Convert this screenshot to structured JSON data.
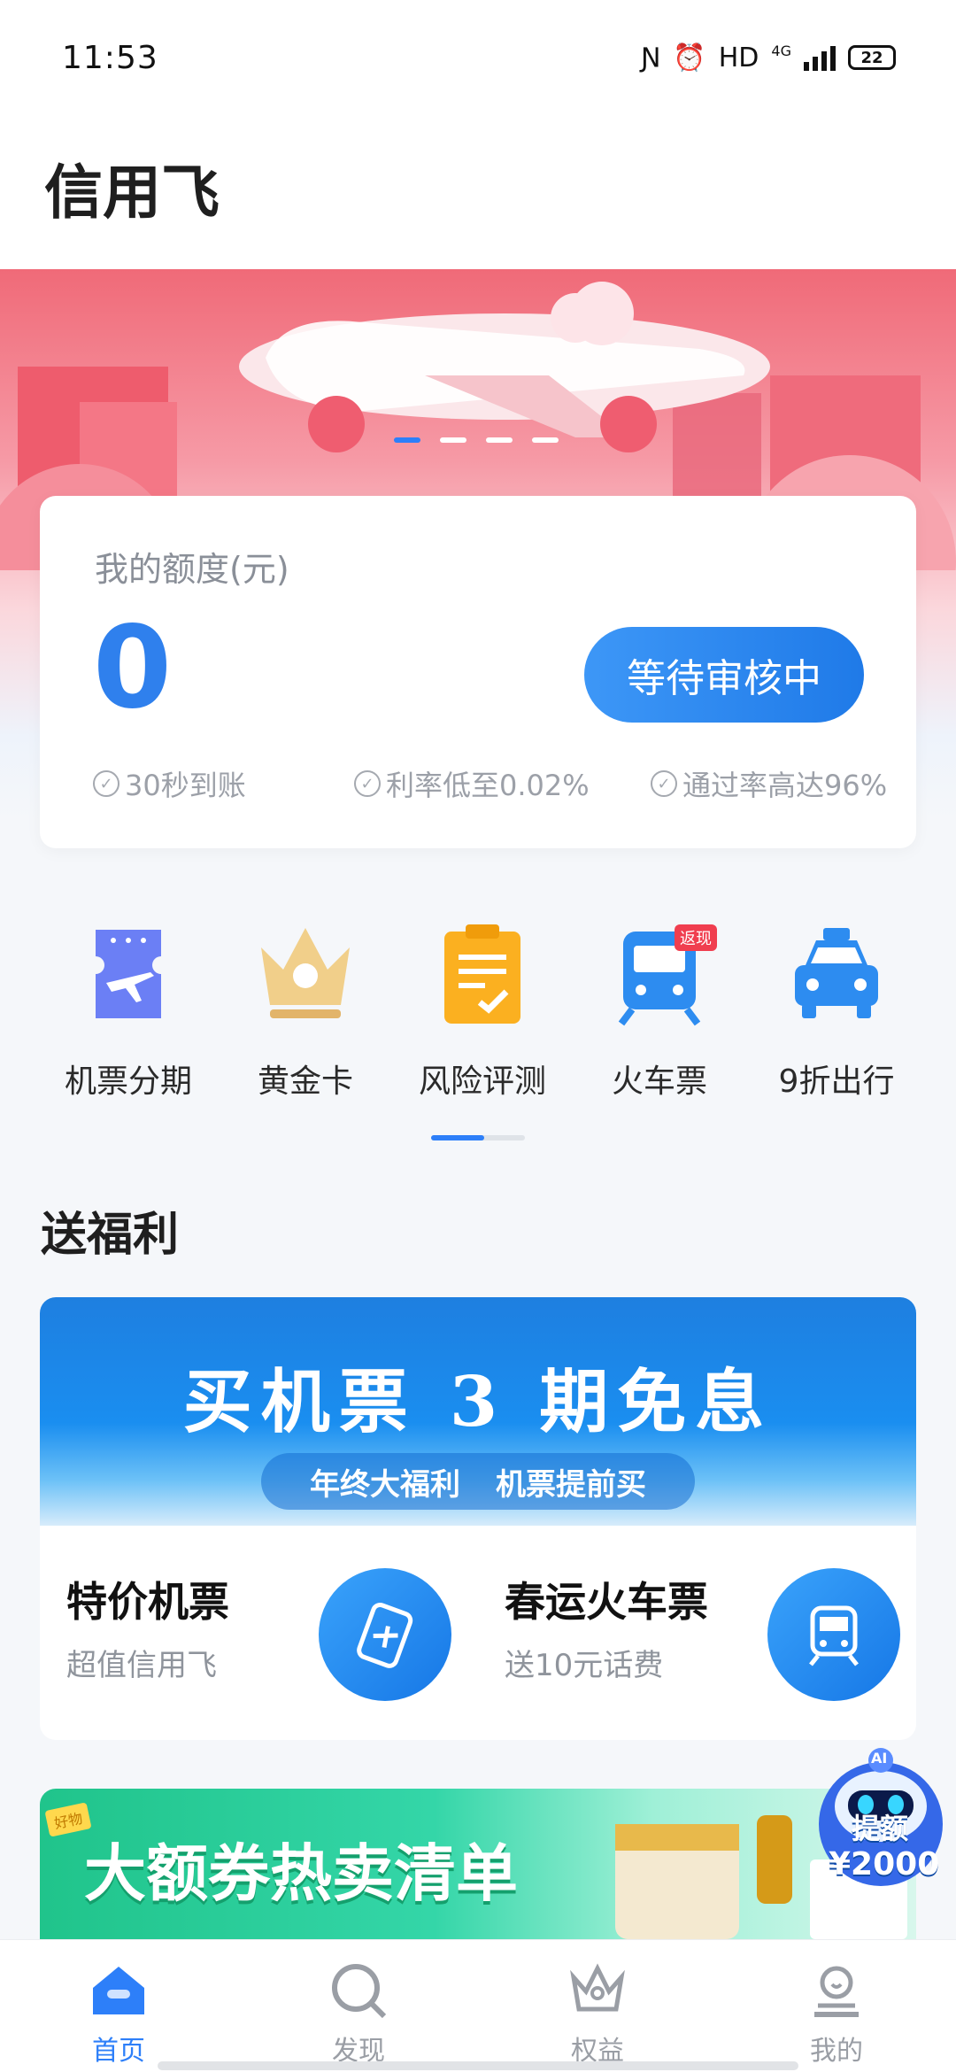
{
  "status_bar": {
    "time": "11:53",
    "hd": "HD",
    "network": "4G",
    "battery": "22"
  },
  "header": {
    "title": "信用飞"
  },
  "colors": {
    "accent": "#2d7ff9",
    "brand_red": "#f06a78",
    "green": "#20c48b"
  },
  "credit": {
    "label": "我的额度(元)",
    "amount": "0",
    "button": "等待审核中",
    "features": [
      "30秒到账",
      "利率低至0.02%",
      "通过率高达96%"
    ]
  },
  "quick_entries": [
    {
      "label": "机票分期",
      "icon": "ticket-plane-icon"
    },
    {
      "label": "黄金卡",
      "icon": "crown-icon"
    },
    {
      "label": "风险评测",
      "icon": "clipboard-icon"
    },
    {
      "label": "火车票",
      "icon": "train-icon",
      "tag": "返现"
    },
    {
      "label": "9折出行",
      "icon": "taxi-icon"
    }
  ],
  "welfare": {
    "title": "送福利",
    "banner_headline": "买机票 3 期免息",
    "banner_sub_1": "年终大福利",
    "banner_sub_2": "机票提前买",
    "promos": [
      {
        "title": "特价机票",
        "subtitle": "超值信用飞",
        "icon": "plane-ticket-icon"
      },
      {
        "title": "春运火车票",
        "subtitle": "送10元话费",
        "icon": "train-icon"
      }
    ]
  },
  "coupon": {
    "title": "大额券热卖清单",
    "tag": "好物"
  },
  "ai_bot": {
    "badge": "AI",
    "label": "提额",
    "amount": "¥2000"
  },
  "bottom_nav": [
    {
      "label": "首页",
      "icon": "home-icon",
      "active": true
    },
    {
      "label": "发现",
      "icon": "search-icon",
      "active": false
    },
    {
      "label": "权益",
      "icon": "crown-icon",
      "active": false
    },
    {
      "label": "我的",
      "icon": "user-icon",
      "active": false
    }
  ]
}
